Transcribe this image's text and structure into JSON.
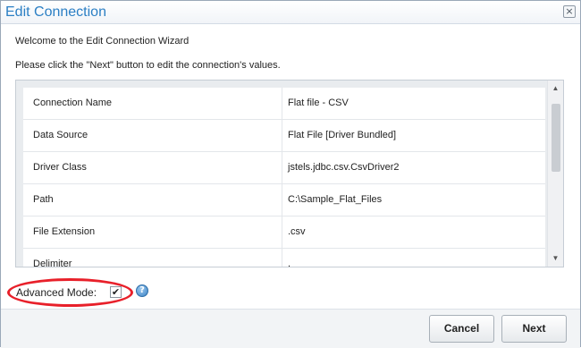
{
  "dialog": {
    "title": "Edit Connection",
    "close_glyph": "×",
    "welcome": "Welcome to the Edit Connection Wizard",
    "instruction": "Please click the \"Next\" button to edit the connection's values."
  },
  "properties": [
    {
      "name": "Connection Name",
      "value": "Flat file - CSV"
    },
    {
      "name": "Data Source",
      "value": "Flat File [Driver Bundled]"
    },
    {
      "name": "Driver Class",
      "value": "jstels.jdbc.csv.CsvDriver2"
    },
    {
      "name": "Path",
      "value": "C:\\Sample_Flat_Files"
    },
    {
      "name": "File Extension",
      "value": ".csv"
    },
    {
      "name": "Delimiter",
      "value": ","
    }
  ],
  "scrollbar": {
    "up_glyph": "▲",
    "down_glyph": "▼"
  },
  "advanced_mode": {
    "label": "Advanced Mode:",
    "checked": true,
    "check_glyph": "✔",
    "help_glyph": "?"
  },
  "footer": {
    "cancel_label": "Cancel",
    "next_label": "Next"
  },
  "colors": {
    "title": "#2b7fc4",
    "highlight": "#e8202a",
    "help_icon": "#3c82c4"
  }
}
